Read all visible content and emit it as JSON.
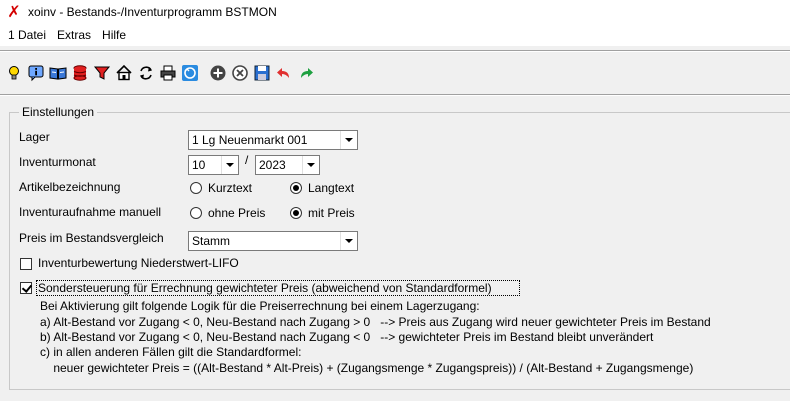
{
  "window": {
    "app_icon": "app-x-icon",
    "title": "xoinv - Bestands-/Inventurprogramm BSTMON"
  },
  "menu": {
    "items": [
      {
        "label": "1 Datei",
        "name": "menu-datei"
      },
      {
        "label": "Extras",
        "name": "menu-extras"
      },
      {
        "label": "Hilfe",
        "name": "menu-hilfe"
      }
    ]
  },
  "toolbar": {
    "icons": [
      "lightbulb-icon",
      "info-icon",
      "book-icon",
      "database-icon",
      "filter-icon",
      "home-icon",
      "refresh-icon",
      "print-icon",
      "exchange-icon",
      "add-icon",
      "cancel-icon",
      "save-icon",
      "undo-icon",
      "redo-icon"
    ]
  },
  "settings": {
    "legend": "Einstellungen",
    "lager_label": "Lager",
    "lager_value": "1  Lg Neuenmarkt  001",
    "inventurmonat_label": "Inventurmonat",
    "month_value": "10",
    "separator": "/",
    "year_value": "2023",
    "artikelbezeichnung_label": "Artikelbezeichnung",
    "kurztext_label": "Kurztext",
    "langtext_label": "Langtext",
    "inventuraufnahme_label": "Inventuraufnahme manuell",
    "ohne_preis_label": "ohne Preis",
    "mit_preis_label": "mit Preis",
    "preis_label": "Preis im Bestandsvergleich",
    "preis_value": "Stamm",
    "lifo_label": "Inventurbewertung Niederstwert-LIFO",
    "sondersteuerung_label": "Sondersteuerung für Errechnung gewichteter Preis (abweichend von Standardformel)",
    "info_lines": [
      "Bei Aktivierung gilt folgende Logik für die Preiserrechnung bei einem Lagerzugang:",
      "a) Alt-Bestand vor Zugang < 0, Neu-Bestand nach Zugang > 0   --> Preis aus Zugang wird neuer gewichteter Preis im Bestand",
      "b) Alt-Bestand vor Zugang < 0, Neu-Bestand nach Zugang < 0   --> gewichteter Preis im Bestand bleibt unverändert",
      "c) in allen anderen Fällen gilt die Standardformel:",
      "    neuer gewichteter Preis = ((Alt-Bestand * Alt-Preis) + (Zugangsmenge * Zugangspreis)) / (Alt-Bestand + Zugangsmenge)"
    ]
  }
}
